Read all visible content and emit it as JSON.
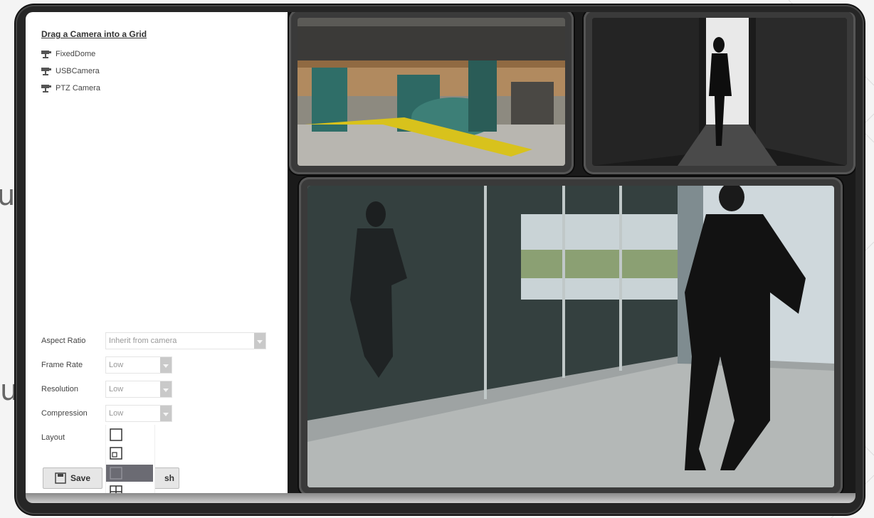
{
  "background_fragments": [
    "up",
    "u"
  ],
  "panel": {
    "title": "Drag a Camera into a Grid",
    "cameras": [
      {
        "label": "FixedDome",
        "icon": "camera-icon"
      },
      {
        "label": "USBCamera",
        "icon": "camera-icon"
      },
      {
        "label": "PTZ Camera",
        "icon": "camera-icon"
      }
    ],
    "settings": {
      "aspect_ratio": {
        "label": "Aspect Ratio",
        "value": "Inherit from camera"
      },
      "frame_rate": {
        "label": "Frame Rate",
        "value": "Low"
      },
      "resolution": {
        "label": "Resolution",
        "value": "Low"
      },
      "compression": {
        "label": "Compression",
        "value": "Low"
      },
      "layout": {
        "label": "Layout",
        "options": [
          "single-icon",
          "two-by-one-icon",
          "three-icon",
          "quad-icon",
          "list-icon"
        ],
        "selected_index": 2
      }
    },
    "buttons": {
      "save": "Save",
      "refresh_partial": "sh"
    }
  },
  "feeds": [
    {
      "name": "Industrial facility",
      "icon": "video-feed"
    },
    {
      "name": "Woman in corridor",
      "icon": "video-feed"
    },
    {
      "name": "Man running by glass building",
      "icon": "video-feed"
    }
  ],
  "colors": {
    "device": "#262626",
    "panel": "#ffffff",
    "selected_layout": "#6b6b73"
  }
}
